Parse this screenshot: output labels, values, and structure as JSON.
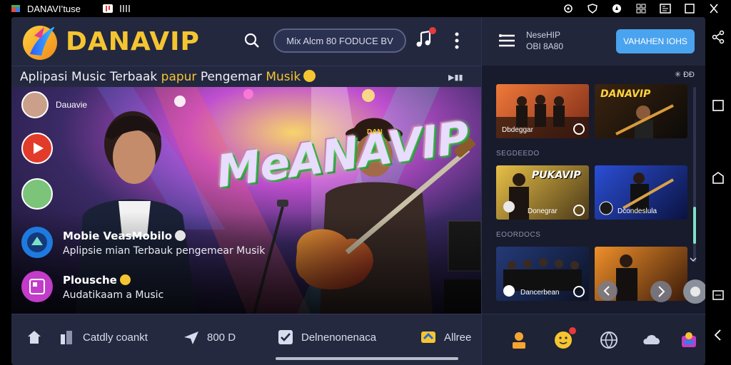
{
  "statusbar": {
    "app_name": "DANAVI’tuse",
    "icons_left": [
      "instagram-icon",
      "music-tile-icon",
      "bars-icon"
    ],
    "icons_right": [
      "wifi-icon",
      "shield-icon",
      "compass-icon",
      "grid-icon",
      "gallery-icon",
      "window-icon",
      "close-icon"
    ]
  },
  "header": {
    "brand": "DANAVIP",
    "search_text": "Mix Alcm 80 FODUCE  BV"
  },
  "tagline": {
    "part1": "Aplipasi Music Terbaak ",
    "part2": "papur ",
    "part3": "Pengemar ",
    "part4": "Musik",
    "share_label": "▶▮▮"
  },
  "hero": {
    "title": "MeANAVIP",
    "hat_text": "DAN",
    "top_avatar_label": "Dauavie",
    "rows": [
      {
        "title": "Mobie VeasMobilo",
        "subtitle": "Aplipsie mian Terbauk pengemear Musik"
      },
      {
        "title": "Plousche",
        "subtitle": "Audatikaam a Music"
      }
    ]
  },
  "bottom_nav": [
    {
      "icon": "home-icon",
      "label": ""
    },
    {
      "icon": "library-icon",
      "label": "Catdly coankt"
    },
    {
      "icon": "airplane-icon",
      "label": "800 D"
    },
    {
      "icon": "check-icon",
      "label": "Delnenonenaca"
    },
    {
      "icon": "store-icon",
      "label": "Allree"
    }
  ],
  "side": {
    "head_line1": "NeseHIP",
    "head_line2": "OBI 8A80",
    "manage_label": "VAHAHEN IOHS",
    "sub_icons": "✳ ĐĐ",
    "sections": [
      "SEGDEEDO",
      "EOORDOCS"
    ],
    "thumbs": [
      {
        "title": "",
        "label": "Dbdeggar"
      },
      {
        "title": "DANAVIP",
        "label": ""
      },
      {
        "title": "PUKAVIP",
        "label": "Donegrar"
      },
      {
        "title": "",
        "label": "Dcondeslula"
      },
      {
        "title": "",
        "label": "Dancerbean"
      },
      {
        "title": "",
        "label": ""
      }
    ]
  },
  "colors": {
    "brand_yellow": "#f5c531",
    "accent_blue": "#4aa3ee",
    "scroll_accent": "#7ee0c6",
    "badge_red": "#e43b3b"
  }
}
